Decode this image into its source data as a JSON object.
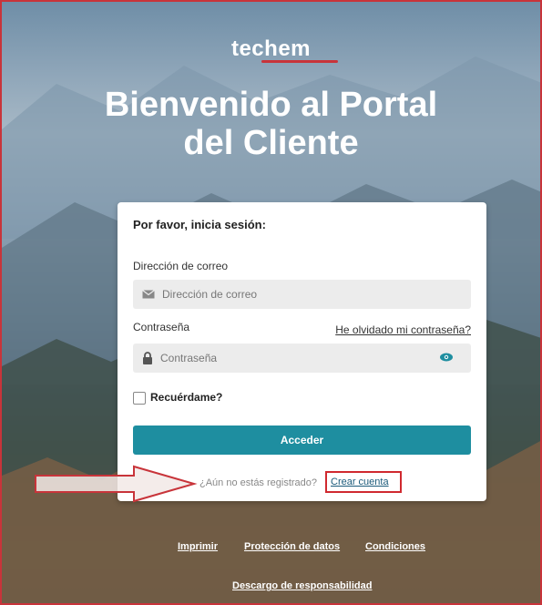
{
  "logo": {
    "text": "techem"
  },
  "hero": {
    "line1": "Bienvenido al Portal",
    "line2": "del Cliente"
  },
  "login": {
    "heading": "Por favor, inicia sesión:",
    "email_label": "Dirección de correo",
    "email_placeholder": "Dirección de correo",
    "password_label": "Contraseña",
    "forgot_link": "He olvidado mi contraseña?",
    "password_placeholder": "Contraseña",
    "remember_label": "Recuérdame?",
    "submit_label": "Acceder",
    "not_registered": "¿Aún no estás registrado?",
    "create_account": "Crear cuenta"
  },
  "footer": {
    "links": [
      "Imprimir",
      "Protección de datos",
      "Condiciones",
      "Descargo de responsabilidad"
    ]
  },
  "colors": {
    "accent": "#1e8ea0",
    "brand_red": "#c8343a"
  },
  "icons": [
    "envelope-icon",
    "lock-icon",
    "eye-icon",
    "arrow-annotation"
  ]
}
